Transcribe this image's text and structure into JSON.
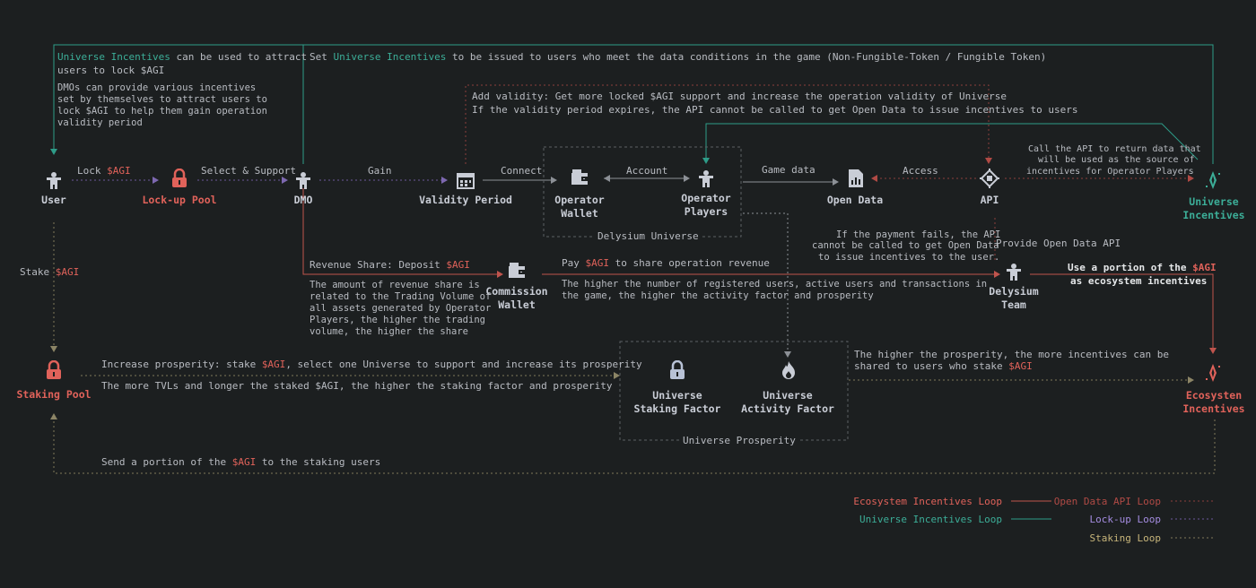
{
  "colors": {
    "background": "#1c1f20",
    "ecosystem_loop": "#c0544d",
    "universe_loop": "#2e9c88",
    "open_data_loop": "#8d3f3b",
    "lockup_loop": "#6c5a9c",
    "staking_loop": "#807a5a",
    "node_text": "#c9cdd6",
    "highlight_teal": "#3cae98",
    "highlight_red": "#e0625a"
  },
  "nodes": {
    "user": "User",
    "lockup_pool": "Lock-up Pool",
    "dmo": "DMO",
    "validity_period": "Validity Period",
    "operator_wallet": "Operator\nWallet",
    "operator_players": "Operator\nPlayers",
    "open_data": "Open Data",
    "api": "API",
    "universe_incentives": "Universe\nIncentives",
    "commission_wallet": "Commission\nWallet",
    "delysium_team": "Delysium\nTeam",
    "staking_pool": "Staking Pool",
    "universe_staking_factor": "Universe\nStaking Factor",
    "universe_activity_factor": "Universe\nActivity Factor",
    "ecosystem_incentives": "Ecosysten\nIncentives"
  },
  "groups": {
    "delysium_universe": "Delysium Universe",
    "universe_prosperity": "Universe Prosperity"
  },
  "edges": {
    "lock": "Lock",
    "select_support": "Select & Support",
    "gain": "Gain",
    "connect": "Connect",
    "account": "Account",
    "game_data": "Game data",
    "access": "Access",
    "stake": "Stake",
    "provide_open_data_api": "Provide Open Data API",
    "revenue_share": "Revenue Share: Deposit",
    "pay": "Pay",
    "pay_suffix": "to share operation revenue",
    "agi": "$AGI"
  },
  "notes": {
    "ui_attract_suffix": "can be used to attract",
    "ui_attract_line2": "users to lock $AGI",
    "dmos_line1": "DMOs can provide various incentives",
    "dmos_line2": "set by themselves to attract users to",
    "dmos_line3": "lock $AGI to help them gain operation",
    "dmos_line4": "validity period",
    "set_prefix": "Set",
    "set_suffix": "to be issued to users who meet the data conditions in the game (Non-Fungible-Token / Fungible Token)",
    "add_validity": "Add validity: Get more locked $AGI support and increase the operation validity of Universe",
    "validity_expires": "If the validity period expires, the API cannot be called to get Open Data to issue incentives to users",
    "call_api_1": "Call the API to return data that",
    "call_api_2": "will be used as the source of",
    "call_api_3": "incentives for Operator Players",
    "payment_fails_1": "If the payment fails, the API",
    "payment_fails_2": "cannot be called to get Open Data",
    "payment_fails_3": "to issue incentives to the user.",
    "revenue_1": "The amount of revenue share is",
    "revenue_2": "related to the Trading Volume of",
    "revenue_3": "all assets generated by Operator",
    "revenue_4": "Players, the higher the trading",
    "revenue_5": "volume, the higher the share",
    "registered_1": "The higher the number of registered users, active users and transactions in",
    "registered_2": "the game, the higher the activity factor and prosperity",
    "use_portion_prefix": "Use a portion of the",
    "use_portion_line2": "as ecosystem incentives",
    "increase_prosperity_prefix": "Increase prosperity: stake",
    "increase_prosperity_suffix": ", select one Universe to support and increase its prosperity",
    "more_tvls": "The more TVLs and longer the staked $AGI, the higher the staking factor and prosperity",
    "higher_prosperity_1": "The higher the prosperity, the more incentives can be",
    "higher_prosperity_2": "shared to users who stake",
    "send_portion_prefix": "Send a portion of the",
    "send_portion_suffix": "to the staking users",
    "universe_incentives": "Universe Incentives"
  },
  "legend": {
    "ecosystem": "Ecosystem Incentives Loop",
    "universe": "Universe Incentives Loop",
    "open_data": "Open Data API Loop",
    "lockup": "Lock-up Loop",
    "staking": "Staking Loop"
  },
  "icons": {
    "user": "person-icon",
    "lockup_pool": "padlock-icon",
    "dmo": "person-icon",
    "validity_period": "calendar-icon",
    "operator_wallet": "wallet-icon",
    "operator_players": "person-icon",
    "open_data": "document-chart-icon",
    "api": "api-chip-icon",
    "universe_incentives": "diamond-sparkle-icon",
    "commission_wallet": "wallet-icon",
    "delysium_team": "person-icon",
    "staking_pool": "padlock-icon",
    "universe_staking_factor": "padlock-icon",
    "universe_activity_factor": "flame-icon",
    "ecosystem_incentives": "diamond-sparkle-icon"
  }
}
